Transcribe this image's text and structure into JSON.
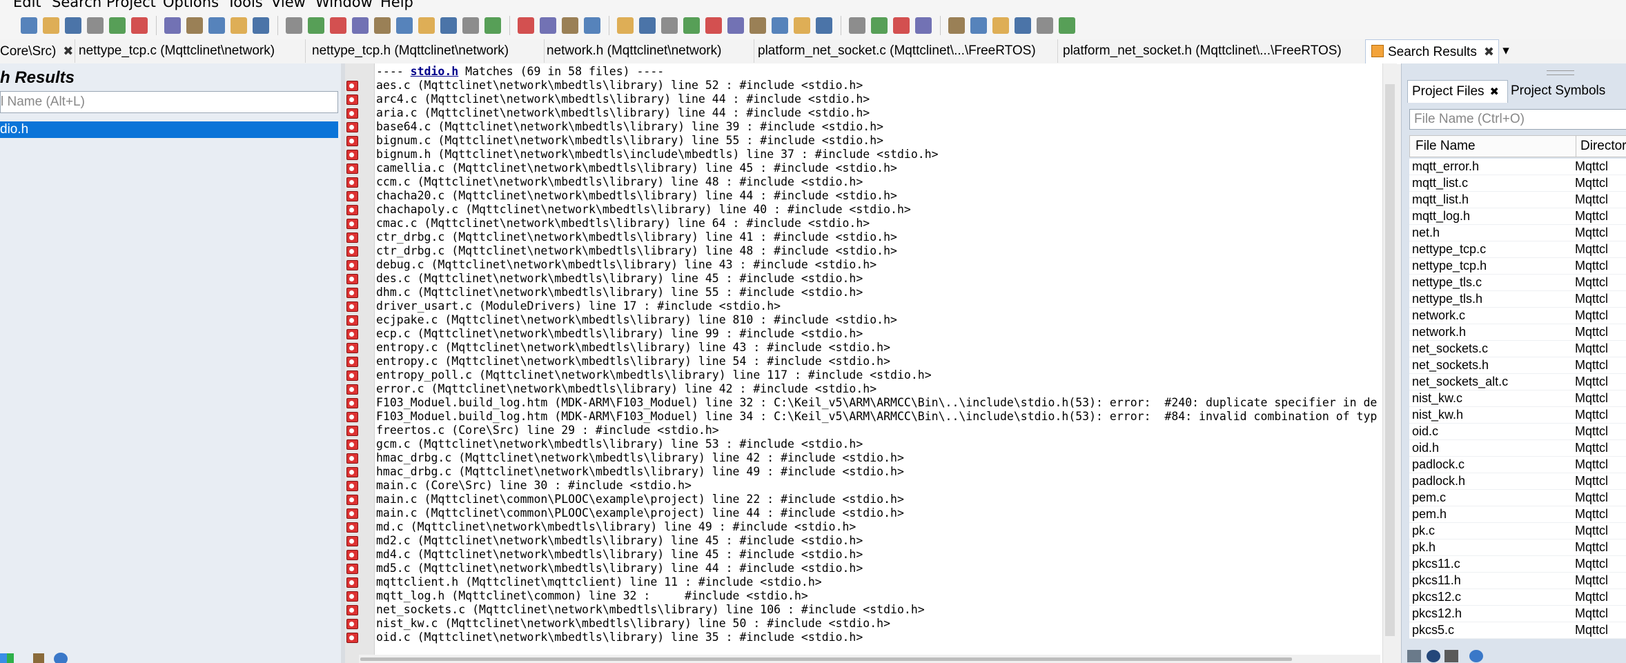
{
  "menu": [
    "Edit",
    "Search",
    "Project",
    "Options",
    "Tools",
    "View",
    "Window",
    "Help"
  ],
  "tabs": [
    {
      "label": "Core\\Src)",
      "close": "✖"
    },
    {
      "label": "nettype_tcp.c (Mqttclinet\\network)"
    },
    {
      "label": "nettype_tcp.h (Mqttclinet\\network)"
    },
    {
      "label": "network.h (Mqttclinet\\network)"
    },
    {
      "label": "platform_net_socket.c (Mqttclinet\\...\\FreeRTOS)"
    },
    {
      "label": "platform_net_socket.h (Mqttclinet\\...\\FreeRTOS)"
    },
    {
      "label": "Search Results",
      "close": "✖"
    }
  ],
  "tab_overflow": "▾",
  "left_panel": {
    "title": "h Results",
    "filter_placeholder": "l Name (Alt+L)",
    "selected_item": "dio.h"
  },
  "results": {
    "header_prefix": "---- ",
    "header_keyword": "stdio.h",
    "header_suffix": " Matches (69 in 58 files) ----",
    "lines": [
      "aes.c (Mqttclinet\\network\\mbedtls\\library) line 52 : #include <stdio.h>",
      "arc4.c (Mqttclinet\\network\\mbedtls\\library) line 44 : #include <stdio.h>",
      "aria.c (Mqttclinet\\network\\mbedtls\\library) line 44 : #include <stdio.h>",
      "base64.c (Mqttclinet\\network\\mbedtls\\library) line 39 : #include <stdio.h>",
      "bignum.c (Mqttclinet\\network\\mbedtls\\library) line 55 : #include <stdio.h>",
      "bignum.h (Mqttclinet\\network\\mbedtls\\include\\mbedtls) line 37 : #include <stdio.h>",
      "camellia.c (Mqttclinet\\network\\mbedtls\\library) line 45 : #include <stdio.h>",
      "ccm.c (Mqttclinet\\network\\mbedtls\\library) line 48 : #include <stdio.h>",
      "chacha20.c (Mqttclinet\\network\\mbedtls\\library) line 44 : #include <stdio.h>",
      "chachapoly.c (Mqttclinet\\network\\mbedtls\\library) line 40 : #include <stdio.h>",
      "cmac.c (Mqttclinet\\network\\mbedtls\\library) line 64 : #include <stdio.h>",
      "ctr_drbg.c (Mqttclinet\\network\\mbedtls\\library) line 41 : #include <stdio.h>",
      "ctr_drbg.c (Mqttclinet\\network\\mbedtls\\library) line 48 : #include <stdio.h>",
      "debug.c (Mqttclinet\\network\\mbedtls\\library) line 43 : #include <stdio.h>",
      "des.c (Mqttclinet\\network\\mbedtls\\library) line 45 : #include <stdio.h>",
      "dhm.c (Mqttclinet\\network\\mbedtls\\library) line 55 : #include <stdio.h>",
      "driver_usart.c (ModuleDrivers) line 17 : #include <stdio.h>",
      "ecjpake.c (Mqttclinet\\network\\mbedtls\\library) line 810 : #include <stdio.h>",
      "ecp.c (Mqttclinet\\network\\mbedtls\\library) line 99 : #include <stdio.h>",
      "entropy.c (Mqttclinet\\network\\mbedtls\\library) line 43 : #include <stdio.h>",
      "entropy.c (Mqttclinet\\network\\mbedtls\\library) line 54 : #include <stdio.h>",
      "entropy_poll.c (Mqttclinet\\network\\mbedtls\\library) line 117 : #include <stdio.h>",
      "error.c (Mqttclinet\\network\\mbedtls\\library) line 42 : #include <stdio.h>",
      "F103_Moduel.build_log.htm (MDK-ARM\\F103_Moduel) line 32 : C:\\Keil_v5\\ARM\\ARMCC\\Bin\\..\\include\\stdio.h(53): error:  #240: duplicate specifier in de",
      "F103_Moduel.build_log.htm (MDK-ARM\\F103_Moduel) line 34 : C:\\Keil_v5\\ARM\\ARMCC\\Bin\\..\\include\\stdio.h(53): error:  #84: invalid combination of typ",
      "freertos.c (Core\\Src) line 29 : #include <stdio.h>",
      "gcm.c (Mqttclinet\\network\\mbedtls\\library) line 53 : #include <stdio.h>",
      "hmac_drbg.c (Mqttclinet\\network\\mbedtls\\library) line 42 : #include <stdio.h>",
      "hmac_drbg.c (Mqttclinet\\network\\mbedtls\\library) line 49 : #include <stdio.h>",
      "main.c (Core\\Src) line 30 : #include <stdio.h>",
      "main.c (Mqttclinet\\common\\PLOOC\\example\\project) line 22 : #include <stdio.h>",
      "main.c (Mqttclinet\\common\\PLOOC\\example\\project) line 44 : #include <stdio.h>",
      "md.c (Mqttclinet\\network\\mbedtls\\library) line 49 : #include <stdio.h>",
      "md2.c (Mqttclinet\\network\\mbedtls\\library) line 45 : #include <stdio.h>",
      "md4.c (Mqttclinet\\network\\mbedtls\\library) line 45 : #include <stdio.h>",
      "md5.c (Mqttclinet\\network\\mbedtls\\library) line 44 : #include <stdio.h>",
      "mqttclient.h (Mqttclinet\\mqttclient) line 11 : #include <stdio.h>",
      "mqtt_log.h (Mqttclinet\\common) line 32 :     #include <stdio.h>",
      "net_sockets.c (Mqttclinet\\network\\mbedtls\\library) line 106 : #include <stdio.h>",
      "nist_kw.c (Mqttclinet\\network\\mbedtls\\library) line 50 : #include <stdio.h>",
      "oid.c (Mqttclinet\\network\\mbedtls\\library) line 35 : #include <stdio.h>"
    ]
  },
  "right_panel": {
    "tabs": [
      {
        "label": "Project Files",
        "close": "✖"
      },
      {
        "label": "Project Symbols"
      }
    ],
    "filter_placeholder": "File Name (Ctrl+O)",
    "columns": [
      "File Name",
      "Director"
    ],
    "files": [
      {
        "name": "mqtt_error.h",
        "dir": "Mqttcl"
      },
      {
        "name": "mqtt_list.c",
        "dir": "Mqttcl"
      },
      {
        "name": "mqtt_list.h",
        "dir": "Mqttcl"
      },
      {
        "name": "mqtt_log.h",
        "dir": "Mqttcl"
      },
      {
        "name": "net.h",
        "dir": "Mqttcl"
      },
      {
        "name": "nettype_tcp.c",
        "dir": "Mqttcl"
      },
      {
        "name": "nettype_tcp.h",
        "dir": "Mqttcl"
      },
      {
        "name": "nettype_tls.c",
        "dir": "Mqttcl"
      },
      {
        "name": "nettype_tls.h",
        "dir": "Mqttcl"
      },
      {
        "name": "network.c",
        "dir": "Mqttcl"
      },
      {
        "name": "network.h",
        "dir": "Mqttcl"
      },
      {
        "name": "net_sockets.c",
        "dir": "Mqttcl"
      },
      {
        "name": "net_sockets.h",
        "dir": "Mqttcl"
      },
      {
        "name": "net_sockets_alt.c",
        "dir": "Mqttcl"
      },
      {
        "name": "nist_kw.c",
        "dir": "Mqttcl"
      },
      {
        "name": "nist_kw.h",
        "dir": "Mqttcl"
      },
      {
        "name": "oid.c",
        "dir": "Mqttcl"
      },
      {
        "name": "oid.h",
        "dir": "Mqttcl"
      },
      {
        "name": "padlock.c",
        "dir": "Mqttcl"
      },
      {
        "name": "padlock.h",
        "dir": "Mqttcl"
      },
      {
        "name": "pem.c",
        "dir": "Mqttcl"
      },
      {
        "name": "pem.h",
        "dir": "Mqttcl"
      },
      {
        "name": "pk.c",
        "dir": "Mqttcl"
      },
      {
        "name": "pk.h",
        "dir": "Mqttcl"
      },
      {
        "name": "pkcs11.c",
        "dir": "Mqttcl"
      },
      {
        "name": "pkcs11.h",
        "dir": "Mqttcl"
      },
      {
        "name": "pkcs12.c",
        "dir": "Mqttcl"
      },
      {
        "name": "pkcs12.h",
        "dir": "Mqttcl"
      },
      {
        "name": "pkcs5.c",
        "dir": "Mqttcl"
      }
    ]
  },
  "toolbar_icons": [
    "new-file-icon",
    "open-folder-icon",
    "save-icon",
    "save-all-icon",
    "save-as-icon",
    "print-icon",
    "cut-icon",
    "copy-icon",
    "paste-icon",
    "undo-icon",
    "redo-icon",
    "page-icon",
    "jump-red-icon",
    "jump-blue-icon",
    "bookmark-icon",
    "browse-icon",
    "symbol-icon",
    "rename-icon",
    "replace-icon",
    "indent-icon",
    "find-r-icon",
    "layout1-icon",
    "layout2-icon",
    "layout3-icon",
    "layout4-icon",
    "project-icon",
    "diagram-icon",
    "tree-icon",
    "relation-icon",
    "graph-icon",
    "window-icon",
    "web-icon",
    "bird-icon",
    "merge-icon",
    "grid-icon",
    "add-icon",
    "add-col-icon",
    "remove-icon",
    "delete-icon",
    "a-icon",
    "b-icon",
    "c-icon",
    "d-icon",
    "e-icon",
    "f-icon"
  ],
  "colors": {
    "accent": "#0a74d8",
    "marker": "#d33333",
    "keyword": "#00008b"
  }
}
